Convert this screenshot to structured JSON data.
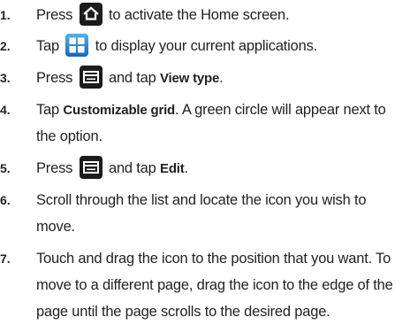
{
  "steps": [
    {
      "number": "1.",
      "before": "Press",
      "icon": "home-key-icon",
      "after": "to activate the Home screen."
    },
    {
      "number": "2.",
      "before": "Tap",
      "icon": "applications-icon",
      "after": "to display your current applications."
    },
    {
      "number": "3.",
      "before": "Press",
      "icon": "menu-key-icon",
      "middle": "and tap",
      "bold": "View type",
      "end": "."
    },
    {
      "number": "4.",
      "before": "Tap",
      "bold": "Customizable grid",
      "after": ". A green circle will appear next to",
      "line2": "the option."
    },
    {
      "number": "5.",
      "before": "Press",
      "icon": "menu-key-icon",
      "middle": "and tap",
      "bold": "Edit",
      "end": "."
    },
    {
      "number": "6.",
      "line1": "Scroll through the list and locate the icon you wish to",
      "line2": "move."
    },
    {
      "number": "7.",
      "line1": "Touch and drag the icon to the position that you want. To",
      "line2": "move to a different page, drag the icon to the edge of the",
      "line3": "page until the page scrolls to the desired page."
    }
  ],
  "colors": {
    "text": "#231f20",
    "key_bg": "#1c1c1c",
    "apps_blue": "#1e7fd0"
  }
}
